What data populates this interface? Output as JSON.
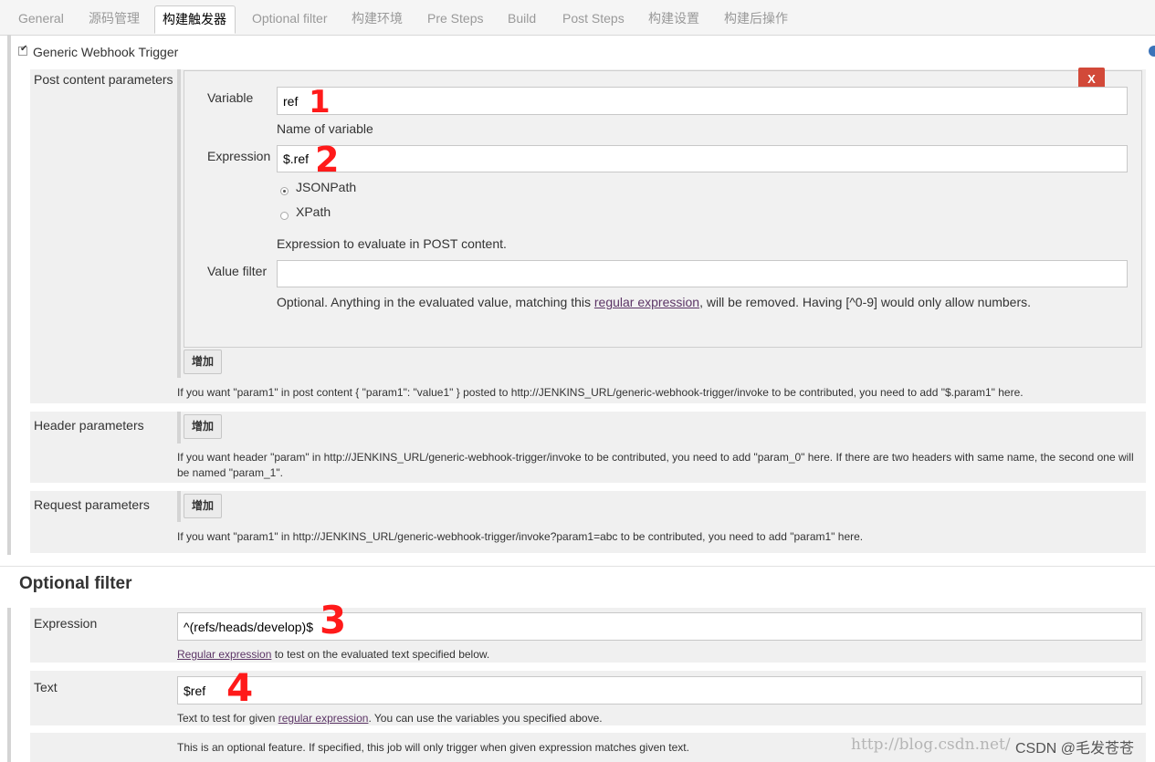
{
  "tabs": [
    {
      "label": "General"
    },
    {
      "label": "源码管理"
    },
    {
      "label": "构建触发器"
    },
    {
      "label": "Optional filter"
    },
    {
      "label": "构建环境"
    },
    {
      "label": "Pre Steps"
    },
    {
      "label": "Build"
    },
    {
      "label": "Post Steps"
    },
    {
      "label": "构建设置"
    },
    {
      "label": "构建后操作"
    }
  ],
  "trigger": {
    "label": "Generic Webhook Trigger",
    "checked": true
  },
  "post_content": {
    "section_label": "Post content parameters",
    "variable_label": "Variable",
    "variable_value": "ref",
    "variable_help": "Name of variable",
    "expression_label": "Expression",
    "expression_value": "$.ref",
    "radio_jsonpath": "JSONPath",
    "radio_xpath": "XPath",
    "expression_help": "Expression to evaluate in POST content.",
    "value_filter_label": "Value filter",
    "value_filter_value": "",
    "value_filter_help_1": "Optional. Anything in the evaluated value, matching this ",
    "value_filter_help_link": "regular expression",
    "value_filter_help_2": ", will be removed. Having [^0-9] would only allow numbers.",
    "delete_label": "X",
    "add_label": "增加",
    "help": "If you want \"param1\" in post content { \"param1\": \"value1\" } posted to http://JENKINS_URL/generic-webhook-trigger/invoke to be contributed, you need to add \"$.param1\" here."
  },
  "header_params": {
    "label": "Header parameters",
    "add_label": "增加",
    "help_1": "If you want header \"param\" in http://JENKINS_URL/generic-webhook-trigger/invoke to be contributed, you need to add \"param_0\" here. If there are two headers with same name, the second one will",
    "help_2": "be named \"param_1\"."
  },
  "request_params": {
    "label": "Request parameters",
    "add_label": "增加",
    "help": "If you want \"param1\" in http://JENKINS_URL/generic-webhook-trigger/invoke?param1=abc to be contributed, you need to add \"param1\" here."
  },
  "optional_filter": {
    "title": "Optional filter",
    "expression_label": "Expression",
    "expression_value": "^(refs/heads/develop)$",
    "expression_help_link": "Regular expression",
    "expression_help": " to test on the evaluated text specified below.",
    "text_label": "Text",
    "text_value": "$ref",
    "text_help_1": "Text to test for given ",
    "text_help_link": "regular expression",
    "text_help_2": ". You can use the variables you specified above.",
    "footer_help": "This is an optional feature. If specified, this job will only trigger when given expression matches given text."
  },
  "annotations": [
    "1",
    "2",
    "3",
    "4"
  ],
  "watermark": "http://blog.csdn.net/",
  "credit": "CSDN @毛发苍苍",
  "colors": {
    "delete_button": "#d24939",
    "marker": "#ff1a1a",
    "link": "#5c3566"
  }
}
